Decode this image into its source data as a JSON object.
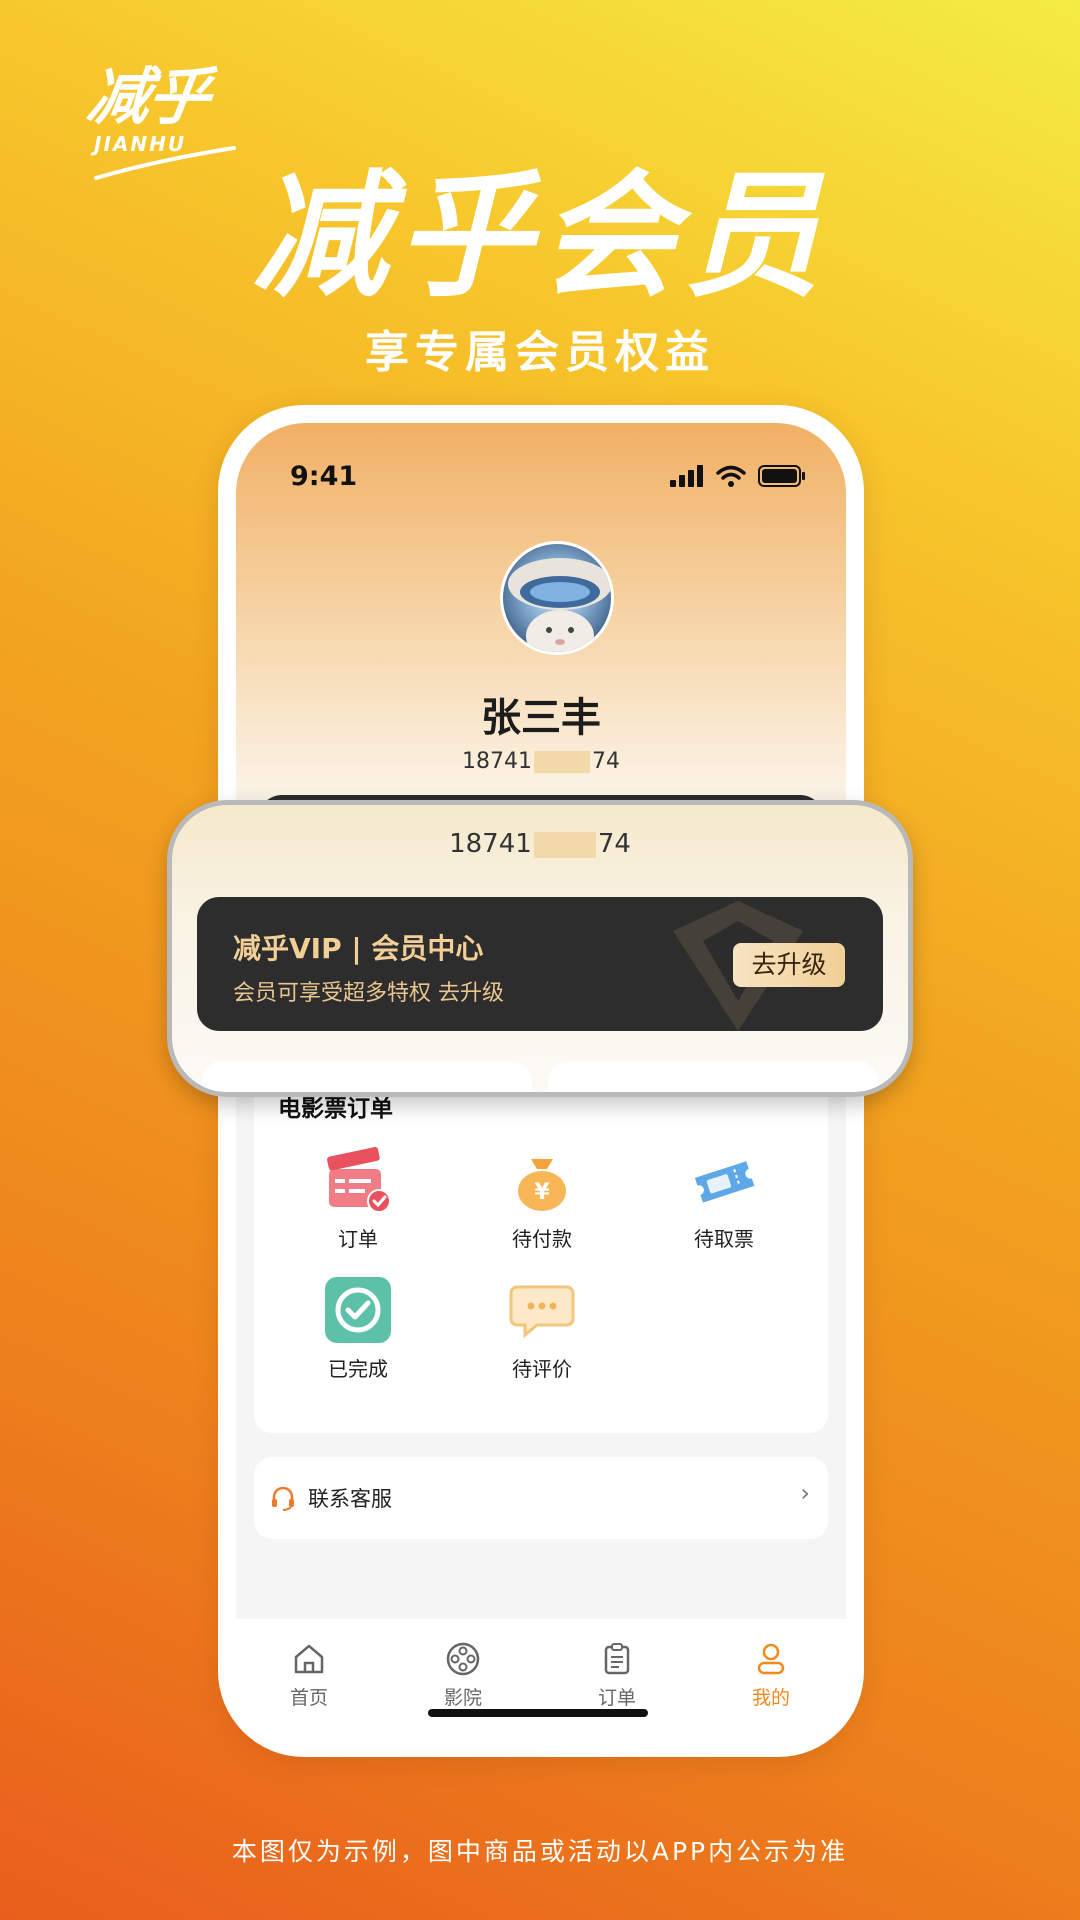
{
  "brand": {
    "logo_cn": "减乎",
    "logo_en": "JIANHU"
  },
  "hero": {
    "title": "减乎会员",
    "subtitle": "享专属会员权益"
  },
  "status_bar": {
    "time": "9:41",
    "icons": [
      "signal-icon",
      "wifi-icon",
      "battery-icon"
    ]
  },
  "profile": {
    "avatar": "avatar-image",
    "name": "张三丰",
    "phone_prefix": "18741",
    "phone_suffix": "74"
  },
  "vip_card": {
    "title": "减乎VIP | 会员中心",
    "description": "会员可享受超多特权 去升级",
    "button_label": "去升级"
  },
  "orders": {
    "title": "电影票订单",
    "items": [
      {
        "label": "订单",
        "icon": "clapperboard-icon"
      },
      {
        "label": "待付款",
        "icon": "money-bag-icon"
      },
      {
        "label": "待取票",
        "icon": "ticket-icon"
      },
      {
        "label": "已完成",
        "icon": "check-circle-icon"
      },
      {
        "label": "待评价",
        "icon": "comment-icon"
      }
    ]
  },
  "service": {
    "label": "联系客服",
    "icon": "headset-icon",
    "arrow": "›"
  },
  "tabbar": {
    "tabs": [
      {
        "label": "首页",
        "icon": "home-icon",
        "active": false
      },
      {
        "label": "影院",
        "icon": "film-reel-icon",
        "active": false
      },
      {
        "label": "订单",
        "icon": "clipboard-icon",
        "active": false
      },
      {
        "label": "我的",
        "icon": "user-icon",
        "active": true
      }
    ]
  },
  "colors": {
    "accent": "#f08a1c",
    "vip_gold": "#f3cf98",
    "vip_dark": "#2d2d2d"
  },
  "footer": {
    "disclaimer": "本图仅为示例，图中商品或活动以APP内公示为准"
  }
}
